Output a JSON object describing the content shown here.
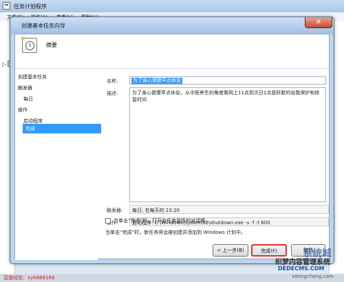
{
  "background_window": {
    "title": "任务计划程序",
    "menu": [
      "文件(F)",
      "操作(A)",
      "查看(V)",
      "帮助(H)"
    ]
  },
  "dialog": {
    "title": "创建基本任务向导",
    "close_glyph": "✕",
    "header_title": "摘要",
    "nav": [
      "创建基本任务",
      "触发器",
      "每日",
      "操作",
      "启动程序",
      "完成"
    ],
    "selected_nav": "完成",
    "name_label": "名称:",
    "name_value": "为了身心健康早点休息",
    "desc_label": "描述:",
    "desc_value": "为了身心健康早点休息，从中医养生的角度看网上11点到次日1点是肝脏的自我保护和修复时间",
    "trigger_label": "触发器:",
    "trigger_value": "每日; 在每天的 23:20",
    "action_label": "操作:",
    "action_value": "启动程序: C:\\Windows\\System32\\shutdown.exe -s -f -t 600",
    "checkbox_label": "当单击“完成”时，打开此任务属性的对话框。",
    "note": "当单击“完成”时，新任务将会被创建并添加到 Windows 计划中。",
    "back_button": "< 上一步(B)",
    "finish_button": "完成(F)",
    "cancel_button": "取消"
  },
  "watermarks": {
    "bottom_left": "百度经验：xyh666168",
    "brand_big": "系统城",
    "brand_cn": "织梦内容管理系统",
    "brand_en": "DEDECMS.COM",
    "site": "xitongcheng.com"
  }
}
